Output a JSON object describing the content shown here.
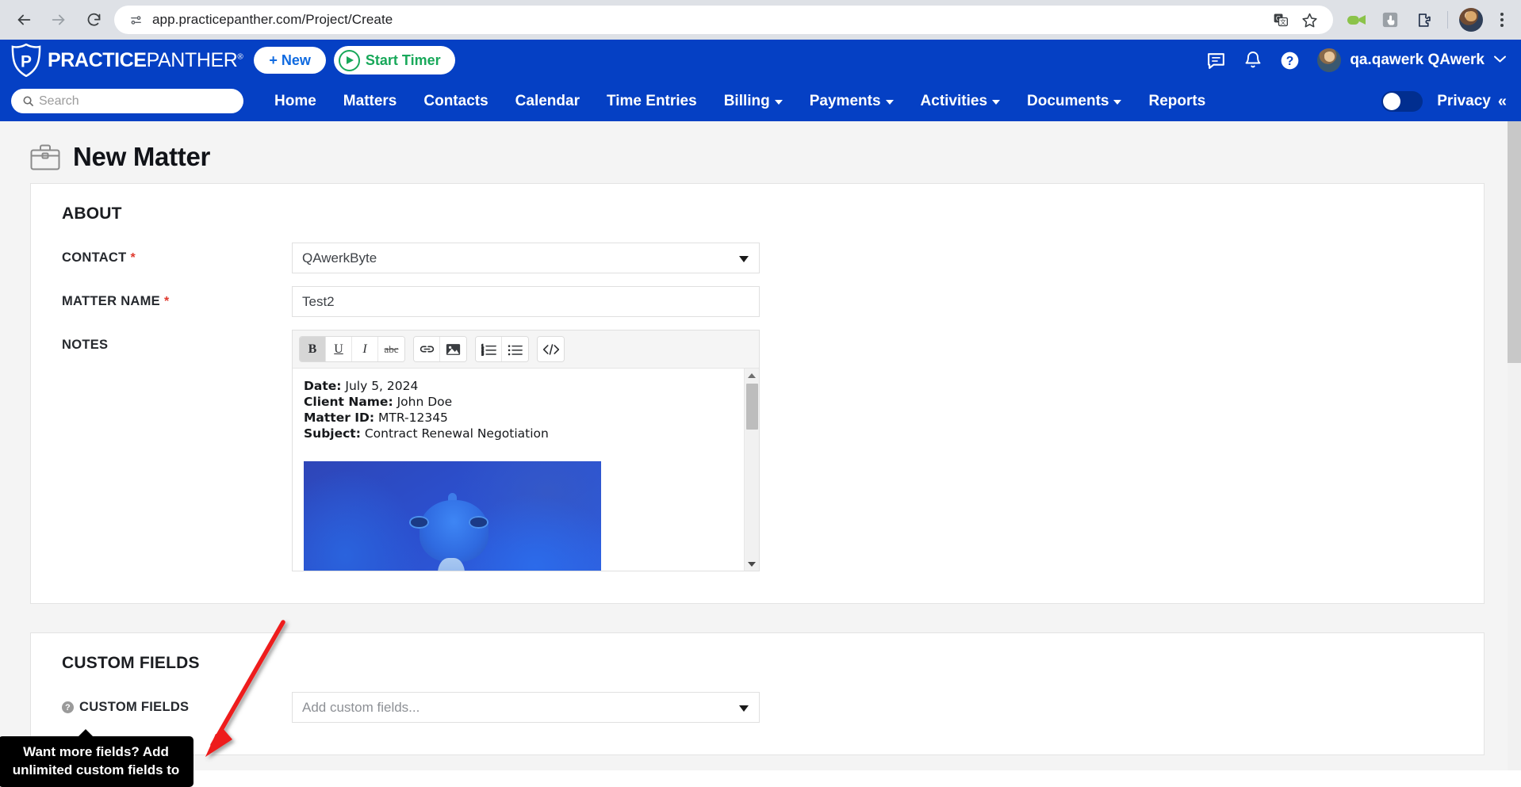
{
  "browser": {
    "url": "app.practicepanther.com/Project/Create",
    "back_label": "Back",
    "forward_label": "Forward",
    "reload_label": "Reload",
    "site_info_label": "View site information",
    "translate_label": "Translate this page",
    "bookmark_label": "Bookmark this tab",
    "ext_loom_label": "Loom extension",
    "ext_capture_label": "Screen capture extension",
    "ext_puzzle_label": "Extensions",
    "profile_label": "Profile",
    "menu_label": "Customize and control Chrome"
  },
  "app_header": {
    "logo_bold": "PRACTICE",
    "logo_thin": "PANTHER",
    "logo_reg": "®",
    "new_button": "+ New",
    "timer_button": "Start Timer",
    "messages_label": "Messages",
    "notifications_label": "Notifications",
    "help_label": "Help",
    "user_name": "qa.qawerk QAwerk"
  },
  "nav": {
    "search_placeholder": "Search",
    "search_value": "",
    "items": [
      {
        "label": "Home",
        "has_caret": false
      },
      {
        "label": "Matters",
        "has_caret": false
      },
      {
        "label": "Contacts",
        "has_caret": false
      },
      {
        "label": "Calendar",
        "has_caret": false
      },
      {
        "label": "Time Entries",
        "has_caret": false
      },
      {
        "label": "Billing",
        "has_caret": true
      },
      {
        "label": "Payments",
        "has_caret": true
      },
      {
        "label": "Activities",
        "has_caret": true
      },
      {
        "label": "Documents",
        "has_caret": true
      },
      {
        "label": "Reports",
        "has_caret": false
      }
    ],
    "privacy_label": "Privacy",
    "privacy_toggle_on": false,
    "collapse_glyph": "«"
  },
  "page": {
    "title": "New Matter",
    "about": {
      "section_title": "ABOUT",
      "contact_label": "CONTACT",
      "contact_required": "*",
      "contact_value": "QAwerkByte",
      "matter_name_label": "MATTER NAME",
      "matter_name_required": "*",
      "matter_name_value": "Test2",
      "notes_label": "NOTES"
    },
    "editor": {
      "buttons": [
        {
          "name": "bold",
          "glyph": "B"
        },
        {
          "name": "underline",
          "glyph": "U"
        },
        {
          "name": "italic",
          "glyph": "I"
        },
        {
          "name": "strikethrough",
          "glyph": "abc"
        },
        {
          "name": "link",
          "glyph": "ὑ7"
        },
        {
          "name": "image",
          "glyph": "image"
        },
        {
          "name": "ordered-list",
          "glyph": "1.2.3."
        },
        {
          "name": "unordered-list",
          "glyph": "bullets"
        },
        {
          "name": "source-code",
          "glyph": "</>"
        }
      ],
      "content": [
        {
          "label": "Date:",
          "value": "July 5, 2024"
        },
        {
          "label": "Client Name:",
          "value": "John Doe"
        },
        {
          "label": "Matter ID:",
          "value": "MTR-12345"
        },
        {
          "label": "Subject:",
          "value": "Contract Renewal Negotiation"
        }
      ],
      "image_alt": "blue chameleon photo"
    },
    "custom_fields": {
      "section_title": "CUSTOM FIELDS",
      "field_label": "CUSTOM FIELDS",
      "help_glyph": "?",
      "placeholder": "Add custom fields..."
    },
    "tooltip": {
      "text": "Want more fields? Add unlimited custom fields to"
    }
  },
  "colors": {
    "brand_blue": "#0540c4",
    "accent_green": "#18a85a",
    "required_red": "#e03a2f",
    "annotation_red": "#ee1b1b",
    "page_bg": "#f4f4f4"
  }
}
